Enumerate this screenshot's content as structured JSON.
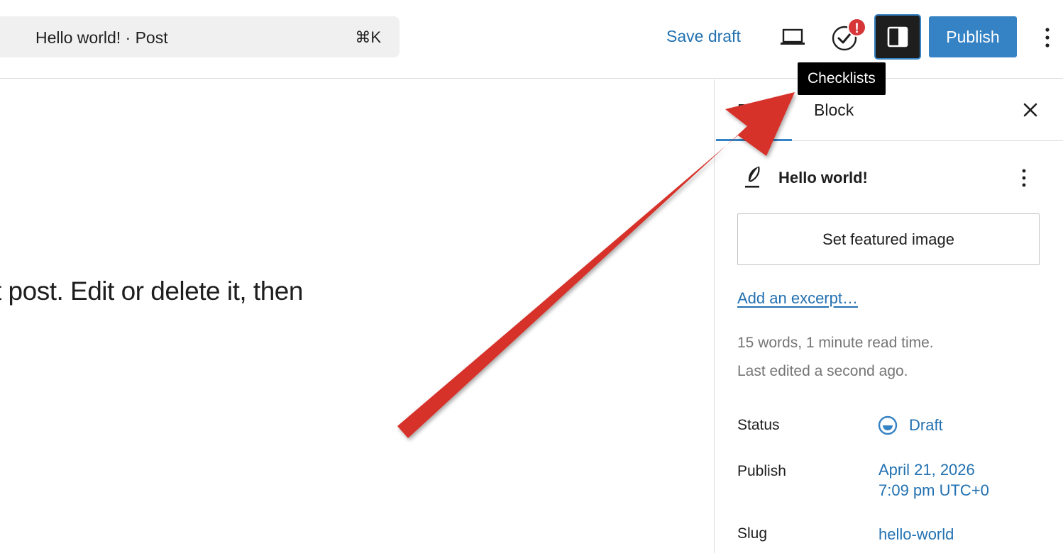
{
  "topbar": {
    "command_title": "Hello world! · Post",
    "command_shortcut": "⌘K",
    "save_draft_label": "Save draft",
    "checklist_badge": "!",
    "publish_label": "Publish"
  },
  "tooltip": {
    "text": "Checklists"
  },
  "canvas": {
    "paragraph": "t post. Edit or delete it, then"
  },
  "sidebar": {
    "tabs": {
      "post": "Post",
      "block": "Block"
    },
    "summary": {
      "title": "Hello world!",
      "featured_image_label": "Set featured image",
      "excerpt_link": "Add an excerpt…",
      "word_count": "15 words, 1 minute read time.",
      "last_edited": "Last edited a second ago."
    },
    "rows": [
      {
        "label": "Status",
        "value": "Draft"
      },
      {
        "label": "Publish",
        "value_line1": "April 21, 2026",
        "value_line2": "7:09 pm UTC+0"
      },
      {
        "label": "Slug",
        "value": "hello-world"
      }
    ]
  },
  "colors": {
    "accent": "#3582c4",
    "link": "#2271b1",
    "badge": "#d63638",
    "arrow": "#d63029",
    "muted_text": "#757575"
  },
  "icons": {
    "view": "laptop-icon",
    "checklist": "checklist-check-icon",
    "sidebar_toggle": "sidebar-panel-icon",
    "more": "vertical-ellipsis-icon",
    "close": "close-icon",
    "post_type": "quill-icon",
    "status": "draft-status-icon"
  }
}
